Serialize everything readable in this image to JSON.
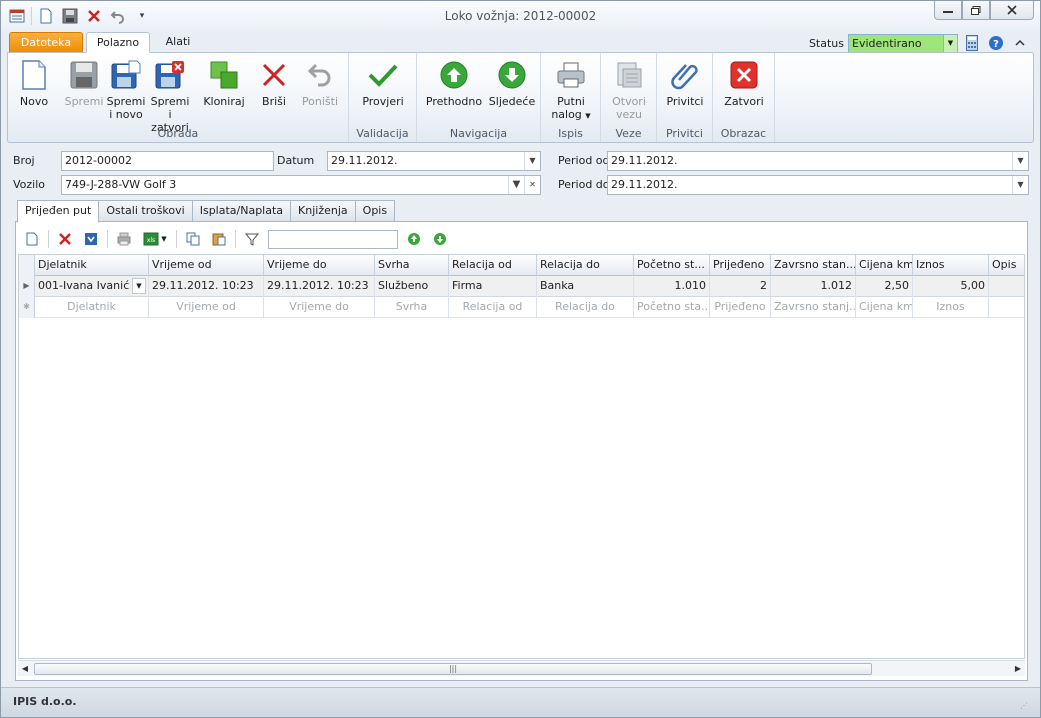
{
  "window": {
    "title": "Loko vožnja: 2012-00002"
  },
  "ribbon_tabs": {
    "file": "Datoteka",
    "home": "Polazno",
    "tools": "Alati"
  },
  "status": {
    "label": "Status",
    "value": "Evidentirano",
    "color": "#9ee57a"
  },
  "ribbon": {
    "novo": "Novo",
    "spremi": "Spremi",
    "spremi_novo": [
      "Spremi",
      "i novo"
    ],
    "spremi_zatvori": [
      "Spremi i",
      "zatvori"
    ],
    "kloniraj": "Kloniraj",
    "brisi": "Briši",
    "ponisti": "Poništi",
    "provjeri": "Provjeri",
    "prethodno": "Prethodno",
    "sljedece": "Sljedeće",
    "putni_nalog": [
      "Putni",
      "nalog"
    ],
    "otvori_vezu": [
      "Otvori",
      "vezu"
    ],
    "privitci": "Privitci",
    "zatvori": "Zatvori",
    "groups": {
      "obrada": "Obrada",
      "validacija": "Validacija",
      "navigacija": "Navigacija",
      "ispis": "Ispis",
      "veze": "Veze",
      "privitci": "Privitci",
      "obrazac": "Obrazac"
    }
  },
  "form": {
    "broj_label": "Broj",
    "broj_value": "2012-00002",
    "datum_label": "Datum",
    "datum_value": "29.11.2012.",
    "period_od_label": "Period od",
    "period_od_value": "29.11.2012.",
    "vozilo_label": "Vozilo",
    "vozilo_value": "749-J-288-VW Golf 3",
    "period_do_label": "Period do",
    "period_do_value": "29.11.2012."
  },
  "page_tabs": [
    "Prijeđen put",
    "Ostali troškovi",
    "Isplata/Naplata",
    "Knjiženja",
    "Opis"
  ],
  "grid": {
    "columns": [
      "Djelatnik",
      "Vrijeme od",
      "Vrijeme do",
      "Svrha",
      "Relacija od",
      "Relacija do",
      "Početno st...",
      "Prijeđeno",
      "Zavrsno stan...",
      "Cijena km",
      "Iznos",
      "Opis"
    ],
    "rows": [
      [
        "001-Ivana Ivanić",
        "29.11.2012. 10:23",
        "29.11.2012. 10:23",
        "Službeno",
        "Firma",
        "Banka",
        "1.010",
        "2",
        "1.012",
        "2,50",
        "5,00",
        ""
      ]
    ],
    "new_row_placeholders": [
      "Djelatnik",
      "Vrijeme od",
      "Vrijeme do",
      "Svrha",
      "Relacija od",
      "Relacija do",
      "Početno sta...",
      "Prijeđeno",
      "Zavrsno stanj...",
      "Cijena km",
      "Iznos",
      ""
    ]
  },
  "statusbar": {
    "company": "IPIS d.o.o."
  }
}
